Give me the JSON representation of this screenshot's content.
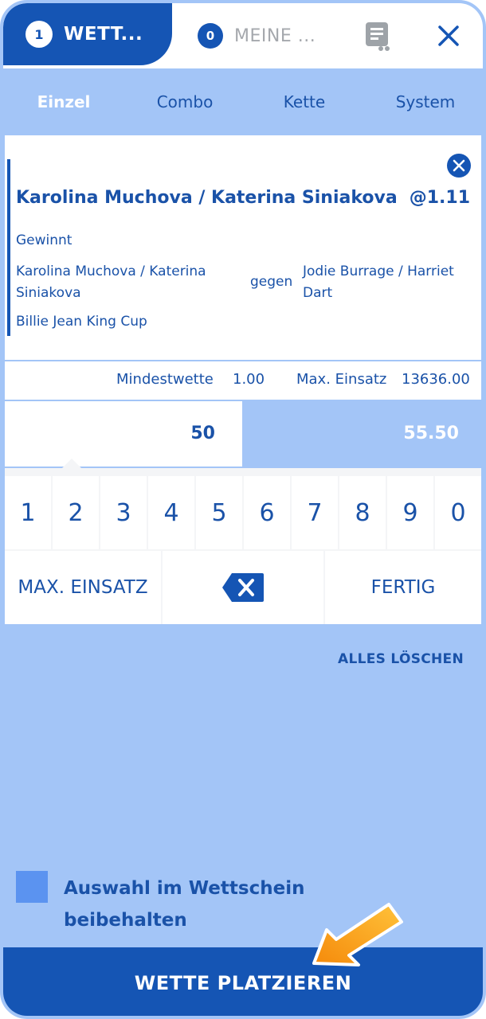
{
  "header": {
    "tab_active": {
      "count": "1",
      "label": "WETT..."
    },
    "tab_inactive": {
      "count": "0",
      "label": "MEINE ..."
    },
    "icons": [
      "receipt-icon",
      "close-icon"
    ]
  },
  "bet_types": [
    "Einzel",
    "Combo",
    "Kette",
    "System"
  ],
  "selection": {
    "title": "Karolina Muchova / Katerina Siniakova",
    "odds": "@1.11",
    "market": "Gewinnt",
    "home": "Karolina Muchova / Katerina Siniakova",
    "versus": "gegen",
    "away": "Jodie Burrage / Harriet Dart",
    "event": "Billie Jean King Cup"
  },
  "limits": {
    "min_label": "Mindestwette",
    "min_value": "1.00",
    "max_label": "Max. Einsatz",
    "max_value": "13636.00"
  },
  "stake": {
    "value": "50",
    "payout": "55.50"
  },
  "keypad": {
    "digits": [
      "1",
      "2",
      "3",
      "4",
      "5",
      "6",
      "7",
      "8",
      "9",
      "0"
    ],
    "max_label": "MAX. EINSATZ",
    "done_label": "FERTIG"
  },
  "clear_all": "ALLES LÖSCHEN",
  "keep_selection": "Auswahl im Wettschein beibehalten",
  "place_bet": "WETTE PLATZIEREN",
  "colors": {
    "primary": "#1555b4",
    "background": "#a3c5f7",
    "text": "#1a52a8",
    "arrow": "#f7941d"
  }
}
